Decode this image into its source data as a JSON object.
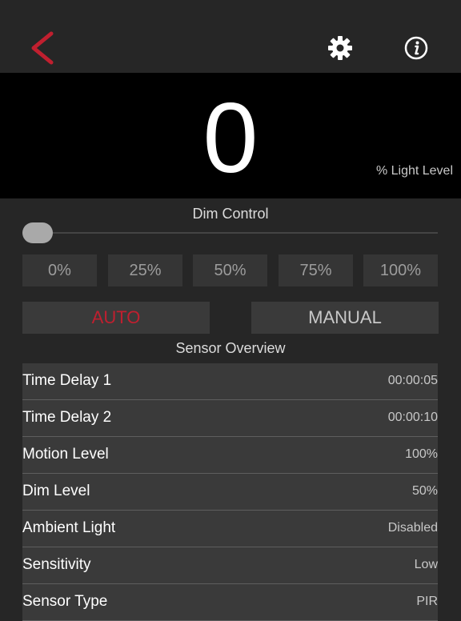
{
  "header": {
    "back_icon": "chevron-left-icon",
    "settings_icon": "gear-icon",
    "info_icon": "info-icon",
    "accent_color": "#c01f2f"
  },
  "light": {
    "value": "0",
    "unit_label": "% Light Level"
  },
  "dim_control": {
    "title": "Dim Control",
    "level_percent": 0,
    "presets": [
      "0%",
      "25%",
      "50%",
      "75%",
      "100%"
    ]
  },
  "modes": {
    "auto_label": "AUTO",
    "manual_label": "MANUAL",
    "selected": "AUTO"
  },
  "sensor_overview": {
    "title": "Sensor Overview",
    "rows": [
      {
        "label": "Time Delay 1",
        "value": "00:00:05"
      },
      {
        "label": "Time Delay 2",
        "value": "00:00:10"
      },
      {
        "label": "Motion Level",
        "value": "100%"
      },
      {
        "label": "Dim Level",
        "value": "50%"
      },
      {
        "label": "Ambient Light",
        "value": "Disabled"
      },
      {
        "label": "Sensitivity",
        "value": "Low"
      },
      {
        "label": "Sensor Type",
        "value": "PIR"
      }
    ]
  }
}
